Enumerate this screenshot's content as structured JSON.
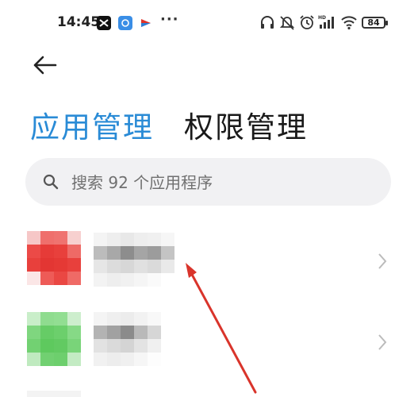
{
  "status_bar": {
    "time": "14:45",
    "battery": "84",
    "app_icons": [
      "capcut-icon",
      "signal-app-icon",
      "tv-app-icon"
    ],
    "right_icons": [
      "headphones-icon",
      "mute-icon",
      "alarm-icon",
      "signal-hd-icon",
      "wifi-icon"
    ]
  },
  "header": {
    "back_icon": "back-arrow-icon",
    "tabs": [
      {
        "label": "应用管理",
        "active": true
      },
      {
        "label": "权限管理",
        "active": false
      }
    ]
  },
  "search": {
    "placeholder": "搜索 92 个应用程序"
  },
  "app_list": [
    {
      "icon_color": "#e8403c",
      "name": "",
      "chevron": "chevron-right-icon"
    },
    {
      "icon_color": "#66cc66",
      "name": "",
      "chevron": "chevron-right-icon"
    }
  ],
  "colors": {
    "accent": "#2a8bd6",
    "annotation_arrow": "#d9342b"
  }
}
